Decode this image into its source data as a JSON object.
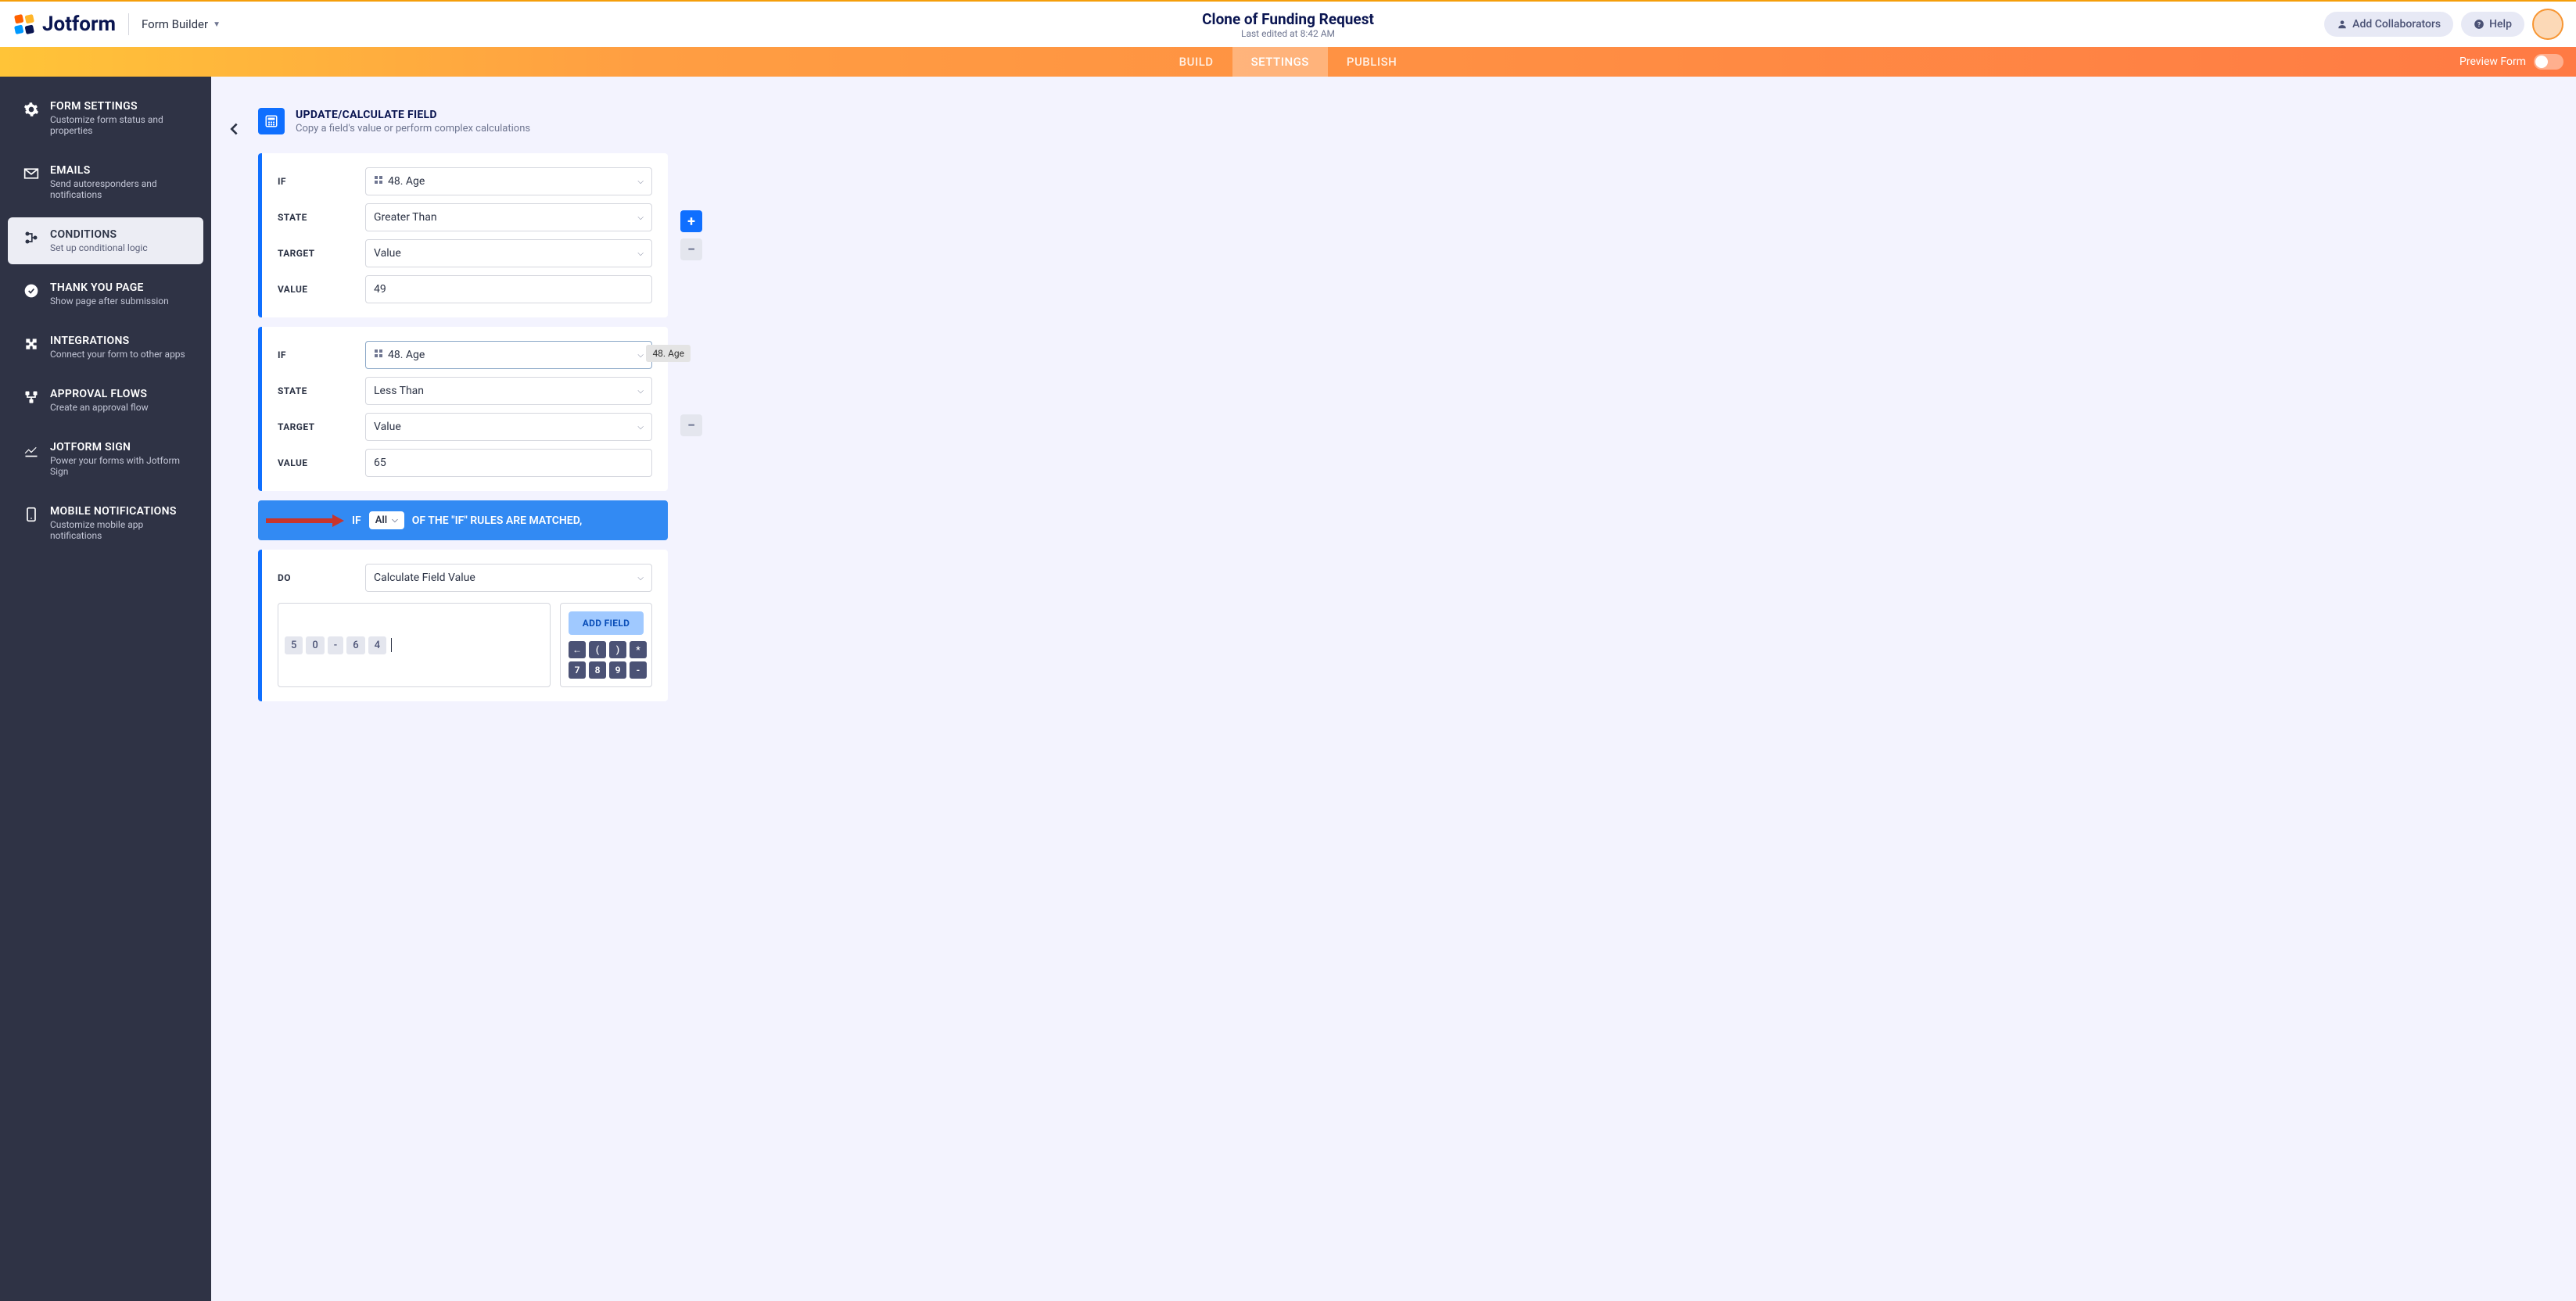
{
  "header": {
    "brand": "Jotform",
    "form_builder_label": "Form Builder",
    "title": "Clone of Funding Request",
    "last_edited": "Last edited at 8:42 AM",
    "add_collaborators": "Add Collaborators",
    "help": "Help"
  },
  "tabs": {
    "build": "BUILD",
    "settings": "SETTINGS",
    "publish": "PUBLISH",
    "preview_label": "Preview Form"
  },
  "sidebar": [
    {
      "title": "FORM SETTINGS",
      "sub": "Customize form status and properties"
    },
    {
      "title": "EMAILS",
      "sub": "Send autoresponders and notifications"
    },
    {
      "title": "CONDITIONS",
      "sub": "Set up conditional logic"
    },
    {
      "title": "THANK YOU PAGE",
      "sub": "Show page after submission"
    },
    {
      "title": "INTEGRATIONS",
      "sub": "Connect your form to other apps"
    },
    {
      "title": "APPROVAL FLOWS",
      "sub": "Create an approval flow"
    },
    {
      "title": "JOTFORM SIGN",
      "sub": "Power your forms with Jotform Sign"
    },
    {
      "title": "MOBILE NOTIFICATIONS",
      "sub": "Customize mobile app notifications"
    }
  ],
  "panel": {
    "title": "UPDATE/CALCULATE FIELD",
    "sub": "Copy a field's value or perform complex calculations"
  },
  "labels": {
    "if": "IF",
    "state": "STATE",
    "target": "TARGET",
    "value": "VALUE",
    "do": "DO"
  },
  "condition1": {
    "if_field": "48. Age",
    "state": "Greater Than",
    "target": "Value",
    "value": "49"
  },
  "condition2": {
    "if_field": "48. Age",
    "state": "Less Than",
    "target": "Value",
    "value": "65",
    "tooltip": "48. Age"
  },
  "matchbar": {
    "if": "IF",
    "all": "All",
    "rest": "OF THE \"IF\" RULES ARE MATCHED,"
  },
  "do_block": {
    "action": "Calculate Field Value",
    "chips": [
      "5",
      "0",
      "-",
      "6",
      "4"
    ],
    "add_field": "ADD FIELD",
    "keys_row1": [
      "←",
      "(",
      ")",
      "*"
    ],
    "keys_row2": [
      "7",
      "8",
      "9",
      "-"
    ]
  }
}
